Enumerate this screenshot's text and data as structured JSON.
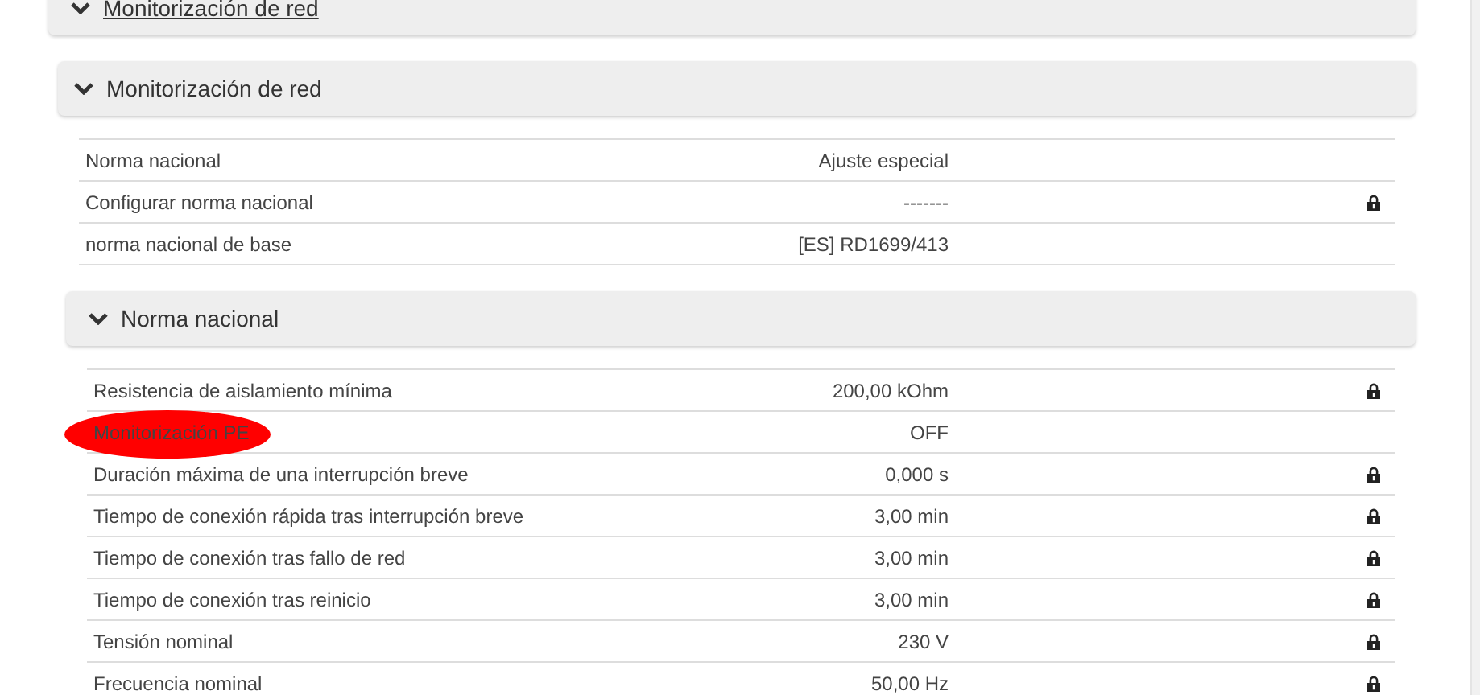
{
  "outer_panel": {
    "title": "Monitorización de red",
    "expanded": true
  },
  "sections": [
    {
      "title": "Monitorización de red",
      "expanded": true,
      "rows": [
        {
          "label": "Norma nacional",
          "value": "Ajuste especial",
          "locked": false,
          "marked": false
        },
        {
          "label": "Configurar norma nacional",
          "value": "-------",
          "locked": true,
          "marked": false
        },
        {
          "label": "norma nacional de base",
          "value": "[ES] RD1699/413",
          "locked": false,
          "marked": false
        }
      ]
    },
    {
      "title": "Norma nacional",
      "expanded": true,
      "rows": [
        {
          "label": "Resistencia de aislamiento mínima",
          "value": "200,00 kOhm",
          "locked": true,
          "marked": false
        },
        {
          "label": "Monitorización PE",
          "value": "OFF",
          "locked": false,
          "marked": true
        },
        {
          "label": "Duración máxima de una interrupción breve",
          "value": "0,000 s",
          "locked": true,
          "marked": false
        },
        {
          "label": "Tiempo de conexión rápida tras interrupción breve",
          "value": "3,00 min",
          "locked": true,
          "marked": false
        },
        {
          "label": "Tiempo de conexión tras fallo de red",
          "value": "3,00 min",
          "locked": true,
          "marked": false
        },
        {
          "label": "Tiempo de conexión tras reinicio",
          "value": "3,00 min",
          "locked": true,
          "marked": false
        },
        {
          "label": "Tensión nominal",
          "value": "230 V",
          "locked": true,
          "marked": false
        },
        {
          "label": "Frecuencia nominal",
          "value": "50,00 Hz",
          "locked": true,
          "marked": false
        }
      ]
    }
  ]
}
